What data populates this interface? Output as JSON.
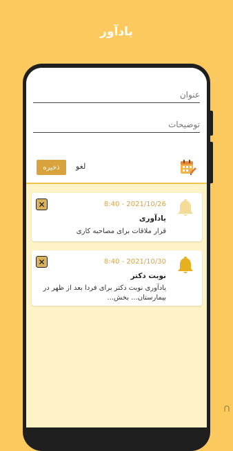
{
  "page": {
    "title": "یادآور"
  },
  "form": {
    "title_placeholder": "عنوان",
    "desc_placeholder": "توضیحات",
    "save_label": "ذخیره",
    "cancel_label": "لغو"
  },
  "reminders": [
    {
      "time": "8:40",
      "separator": "-",
      "date": "2021/10/26",
      "title": "یادآوری",
      "body": "قرار ملاقات برای مصاحبه کاری",
      "bell_state": "muted",
      "close_label": "✕"
    },
    {
      "time": "8:40",
      "separator": "-",
      "date": "2021/10/30",
      "title": "نوبت دکتر",
      "body": "یادآوری نوبت دکتر برای فردا بعد از ظهر در بیمارستان... بخش...",
      "bell_state": "active",
      "close_label": "✕"
    }
  ],
  "colors": {
    "background": "#fcc95e",
    "accent": "#d8a23d",
    "list_background": "#fdf3c6",
    "bell_active": "#e6b021",
    "bell_muted": "#f3dc96"
  },
  "icons": [
    "calendar-edit-icon",
    "bell-icon",
    "close-icon"
  ]
}
